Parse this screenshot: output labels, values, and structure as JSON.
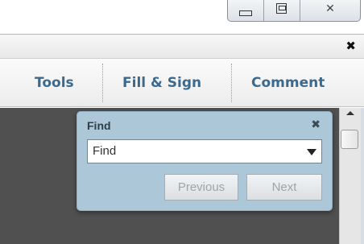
{
  "window": {
    "minimize_icon": "minimize-icon",
    "maximize_icon": "maximize-icon",
    "close_icon": "close-icon",
    "close_glyph": "✕"
  },
  "docbar": {
    "close_glyph": "✖"
  },
  "toolbar": {
    "tools_label": "Tools",
    "fill_sign_label": "Fill & Sign",
    "comment_label": "Comment"
  },
  "find_panel": {
    "title": "Find",
    "close_glyph": "✖",
    "combo_value": "Find",
    "previous_label": "Previous",
    "next_label": "Next"
  },
  "colors": {
    "task_text": "#3c6a8f",
    "find_panel_bg": "#acc7d7",
    "doc_bg": "#505050"
  }
}
